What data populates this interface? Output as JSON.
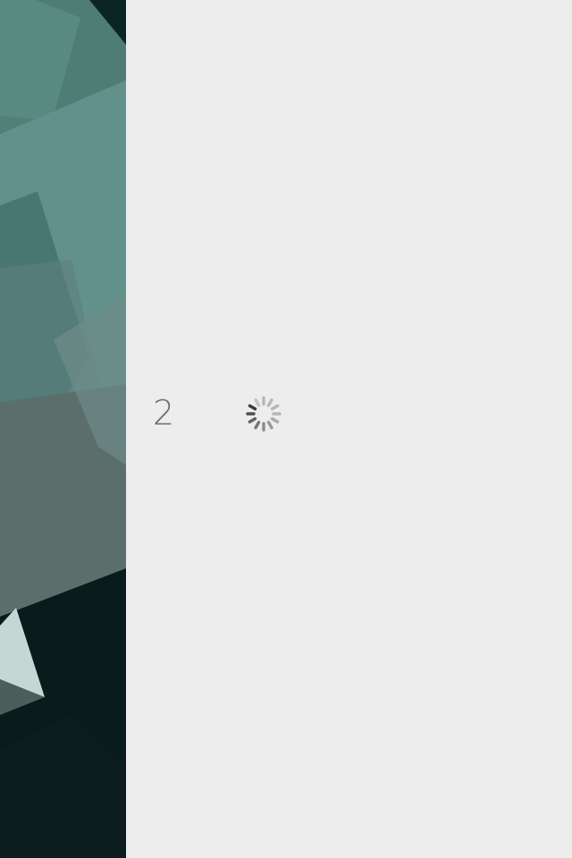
{
  "screen": {
    "step_number": "2",
    "loading_state": "loading"
  },
  "colors": {
    "background": "#ededed",
    "step_text": "#6b6b6b",
    "wallpaper_dark": "#061716",
    "wallpaper_teal": "#5e8a83"
  },
  "icons": {
    "spinner": "loading-spinner-icon"
  }
}
